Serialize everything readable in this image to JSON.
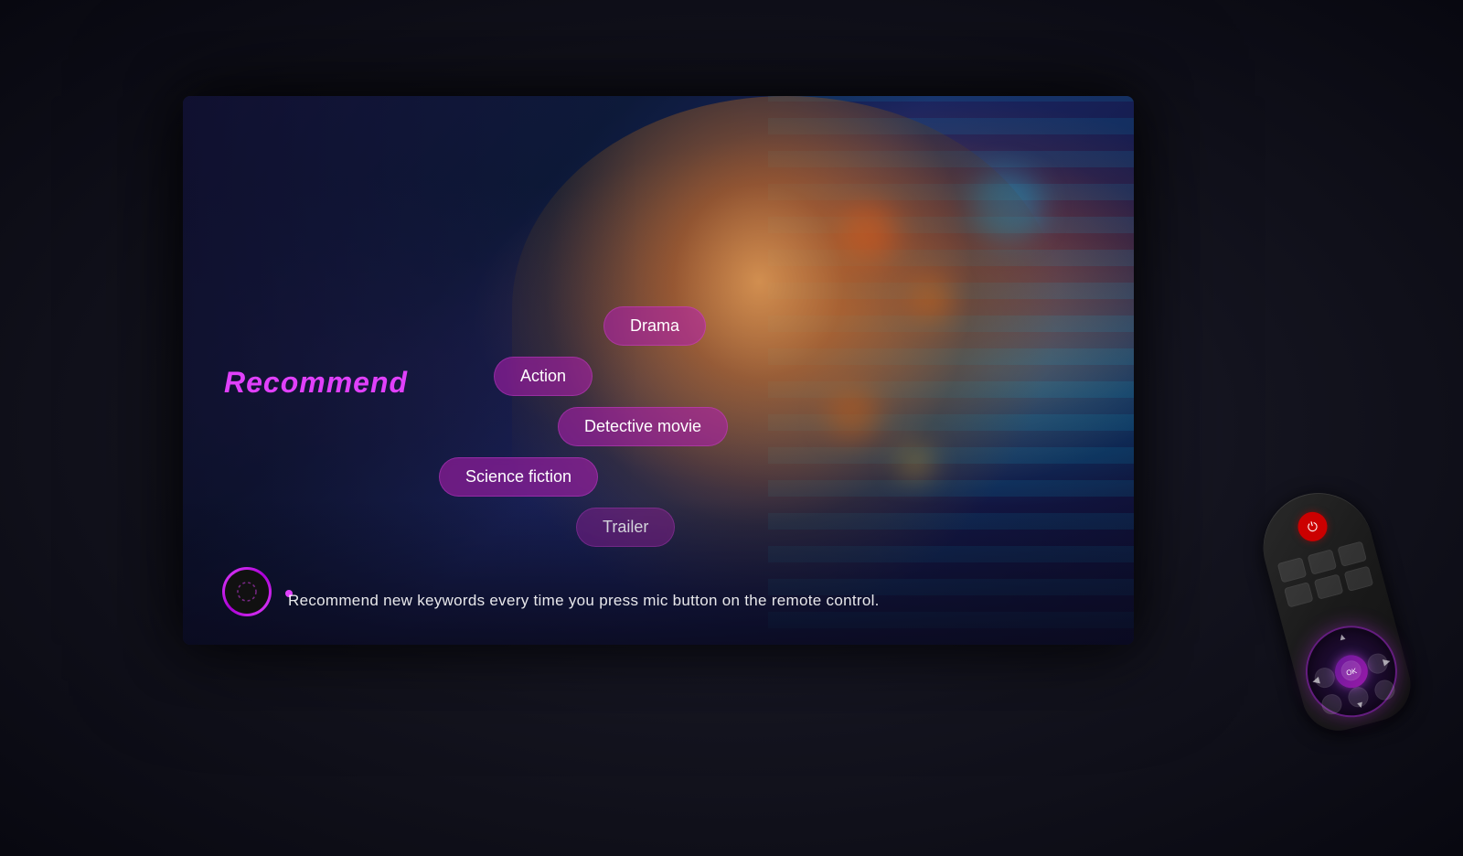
{
  "scene": {
    "background_color": "#0d0d1a",
    "tv": {
      "frame_color": "#111111"
    },
    "recommend_label": "Recommend",
    "genre_tags": [
      {
        "id": "drama",
        "label": "Drama",
        "offset": 180
      },
      {
        "id": "action",
        "label": "Action",
        "offset": 60
      },
      {
        "id": "detective",
        "label": "Detective movie",
        "offset": 130
      },
      {
        "id": "scifi",
        "label": "Science fiction",
        "offset": 0
      },
      {
        "id": "trailer",
        "label": "Trailer",
        "offset": 150
      }
    ],
    "bottom_text": "Recommend new keywords every time you press mic button on the remote control.",
    "remote": {
      "has_power_button": true,
      "has_nav_ring": true,
      "nav_ring_color": "#6a1a9a"
    }
  }
}
